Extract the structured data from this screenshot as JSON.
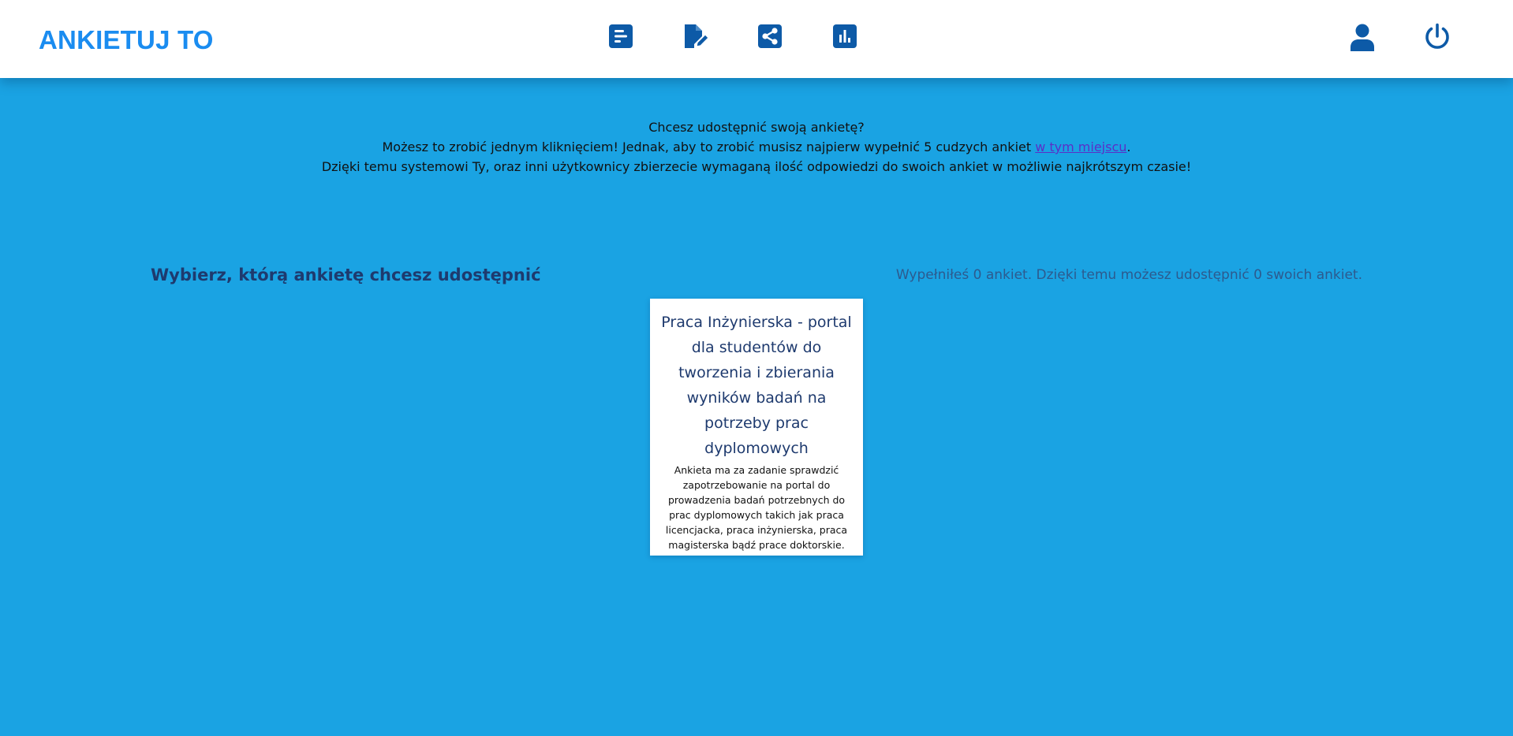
{
  "app": {
    "logo": "ANKIETUJ TO"
  },
  "colors": {
    "background": "#1aa3e3",
    "navbar": "#ffffff",
    "logo": "#1a8cf0",
    "icon": "#0d5aa7",
    "heading": "#1e3a6e"
  },
  "nav": {
    "icons": [
      {
        "name": "surveys-list-icon"
      },
      {
        "name": "edit-survey-icon"
      },
      {
        "name": "share-icon"
      },
      {
        "name": "results-chart-icon"
      }
    ],
    "right_icons": [
      {
        "name": "user-profile-icon"
      },
      {
        "name": "power-logout-icon"
      }
    ]
  },
  "info": {
    "line1": "Chcesz udostępnić swoją ankietę?",
    "line2_before": "Możesz to zrobić jednym kliknięciem! Jednak, aby to zrobić musisz najpierw wypełnić 5 cudzych ankiet ",
    "line2_link": "w tym miejscu",
    "line2_after": ".",
    "line3": "Dzięki temu systemowi Ty, oraz inni użytkownicy zbierzecie wymaganą ilość odpowiedzi do swoich ankiet w możliwie najkrótszym czasie!"
  },
  "section": {
    "title": "Wybierz, którą ankietę chcesz udostępnić",
    "status": "Wypełniłeś 0 ankiet. Dzięki temu możesz udostępnić 0 swoich ankiet."
  },
  "surveys": [
    {
      "title": "Praca Inżynierska - portal dla studentów do tworzenia i zbierania wyników badań na potrzeby prac dyplomowych",
      "description": "Ankieta ma za zadanie sprawdzić zapotrzebowanie na portal do prowadzenia badań potrzebnych do prac dyplomowych takich jak praca licencjacka, praca inżynierska, praca magisterska bądź prace doktorskie."
    }
  ]
}
